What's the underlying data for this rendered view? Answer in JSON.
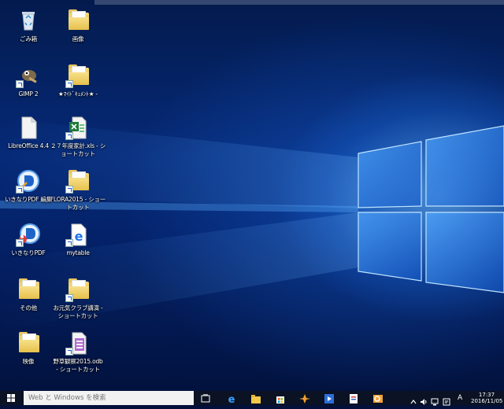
{
  "desktop": {
    "icons": [
      {
        "label": "ごみ箱"
      },
      {
        "label": "画像"
      },
      {
        "label": "GIMP 2"
      },
      {
        "label": "★ﾏｲﾄﾞｷｭﾒﾝﾄ★ -"
      },
      {
        "label": "LibreOffice 4.4"
      },
      {
        "label": "２７年度家計.xls - シ\nョートカット"
      },
      {
        "label": "いきなりPDF 編集"
      },
      {
        "label": "FLORA2015 - ショー\nトカット"
      },
      {
        "label": "いきなりPDF"
      },
      {
        "label": "mytable"
      },
      {
        "label": "その他"
      },
      {
        "label": "お元気クラブ講演 -\nショートカット"
      },
      {
        "label": "映像"
      },
      {
        "label": "野草観察2015.odb\n- ショートカット"
      }
    ]
  },
  "taskbar": {
    "search_placeholder": "Web と Windows を検索",
    "ime_mode": "A",
    "time": "17:37",
    "date": "2016/11/05"
  },
  "colors": {
    "taskbar": "#0b1223",
    "search_bg": "#f2f2f2",
    "accent": "#1b74e8"
  }
}
